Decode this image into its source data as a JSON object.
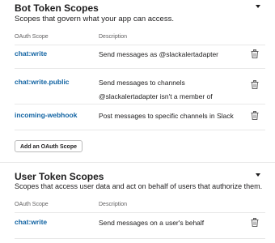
{
  "bot_section": {
    "title": "Bot Token Scopes",
    "subtitle": "Scopes that govern what your app can access.",
    "col_scope": "OAuth Scope",
    "col_desc": "Description",
    "rows": [
      {
        "scope": "chat:write",
        "desc_1": "Send messages as @slackalertadapter",
        "desc_2": ""
      },
      {
        "scope": "chat:write.public",
        "desc_1": "Send messages to channels",
        "desc_2": "@slackalertadapter isn't a member of"
      },
      {
        "scope": "incoming-webhook",
        "desc_1": "Post messages to specific channels in Slack",
        "desc_2": ""
      }
    ],
    "add_button": "Add an OAuth Scope"
  },
  "user_section": {
    "title": "User Token Scopes",
    "subtitle": "Scopes that access user data and act on behalf of users that authorize them.",
    "col_scope": "OAuth Scope",
    "col_desc": "Description",
    "rows": [
      {
        "scope": "chat:write",
        "desc_1": "Send messages on a user's behalf",
        "desc_2": ""
      }
    ]
  },
  "icons": {
    "delete": "trash-icon",
    "collapse": "chevron-down-icon"
  },
  "colors": {
    "link": "#1264a3",
    "text": "#1d1c1d",
    "muted": "#616061"
  }
}
